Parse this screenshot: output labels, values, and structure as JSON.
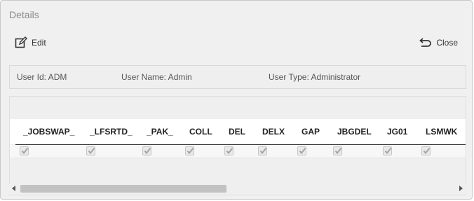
{
  "panel": {
    "title": "Details"
  },
  "toolbar": {
    "edit_label": "Edit",
    "close_label": "Close"
  },
  "info": {
    "user_id": "User Id: ADM",
    "user_name": "User Name: Admin",
    "user_type": "User Type: Administrator"
  },
  "grid": {
    "columns": [
      "_JOBSWAP_",
      "_LFSRTD_",
      "_PAK_",
      "COLL",
      "DEL",
      "DELX",
      "GAP",
      "JBGDEL",
      "JG01",
      "LSMWK"
    ],
    "row": [
      true,
      true,
      true,
      true,
      true,
      true,
      true,
      true,
      true,
      true
    ]
  },
  "icons": {
    "edit": "edit-pencil-icon",
    "close": "undo-arrow-icon",
    "checkbox": "check-icon"
  }
}
